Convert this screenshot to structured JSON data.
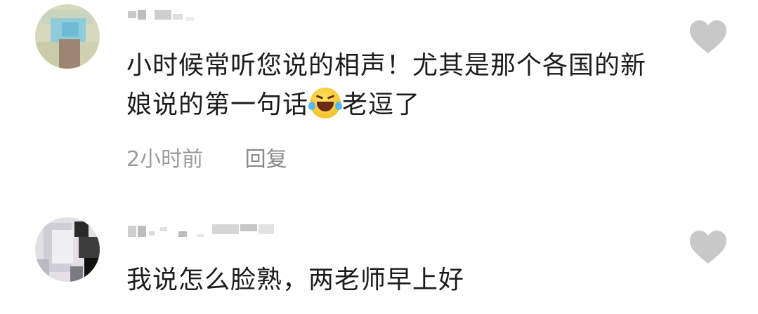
{
  "comments": [
    {
      "avatar_colors": {
        "bg": "#d9d9bd",
        "accent": "#7ec7de",
        "dark": "#9a8470"
      },
      "text_before_emoji": "小时候常听您说的相声！尤其是那个各国的新娘说的第一句话",
      "emoji_icon": "laughing-crying-face-icon",
      "text_after_emoji": "老逗了",
      "time": "2小时前",
      "reply_label": "回复",
      "like_icon": "heart-icon"
    },
    {
      "avatar_colors": {
        "bg": "#e6e4ea",
        "accent": "#b8b6bf",
        "dark": "#1a1a1a"
      },
      "text": "我说怎么脸熟，两老师早上好",
      "like_icon": "heart-icon"
    }
  ],
  "colors": {
    "text": "#1c1c1c",
    "meta": "#9a9a9a",
    "heart": "#c8c8c8"
  }
}
